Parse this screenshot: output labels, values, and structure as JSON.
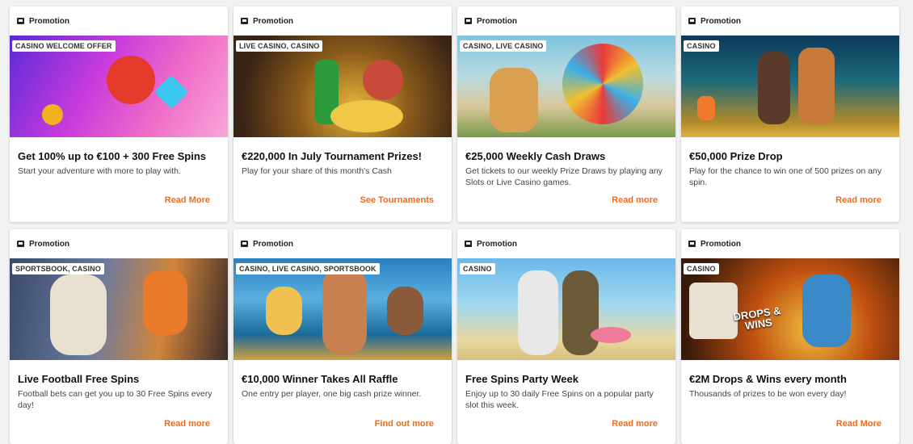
{
  "cards": [
    {
      "header": "Promotion",
      "tag": "CASINO WELCOME OFFER",
      "title": "Get 100% up to €100 + 300 Free Spins",
      "desc": "Start your adventure with more to play with.",
      "cta": "Read More"
    },
    {
      "header": "Promotion",
      "tag": "LIVE CASINO, CASINO",
      "title": "€220,000 In July Tournament Prizes!",
      "desc": "Play for your share of this month's Cash",
      "cta": "See Tournaments"
    },
    {
      "header": "Promotion",
      "tag": "CASINO, LIVE CASINO",
      "title": "€25,000 Weekly Cash Draws",
      "desc": "Get tickets to our weekly Prize Draws by playing any Slots or Live Casino games.",
      "cta": "Read more"
    },
    {
      "header": "Promotion",
      "tag": "CASINO",
      "title": "€50,000 Prize Drop",
      "desc": "Play for the chance to win one of 500 prizes on any spin.",
      "cta": "Read more"
    },
    {
      "header": "Promotion",
      "tag": "SPORTSBOOK, CASINO",
      "title": "Live Football Free Spins",
      "desc": "Football bets can get you up to 30 Free Spins every day!",
      "cta": "Read more"
    },
    {
      "header": "Promotion",
      "tag": "CASINO, LIVE CASINO, SPORTSBOOK",
      "title": "€10,000 Winner Takes All Raffle",
      "desc": "One entry per player, one big cash prize winner.",
      "cta": "Find out more"
    },
    {
      "header": "Promotion",
      "tag": "CASINO",
      "title": "Free Spins Party Week",
      "desc": "Enjoy up to 30 daily Free Spins on a popular party slot this week.",
      "cta": "Read more"
    },
    {
      "header": "Promotion",
      "tag": "CASINO",
      "title": "€2M Drops & Wins every month",
      "desc": "Thousands of prizes to be won every day!",
      "cta": "Read More",
      "banner_text": "DROPS & WINS"
    }
  ],
  "colors": {
    "accent": "#f06a1c",
    "text": "#111111",
    "card": "#ffffff",
    "background": "#f2f2f2"
  }
}
